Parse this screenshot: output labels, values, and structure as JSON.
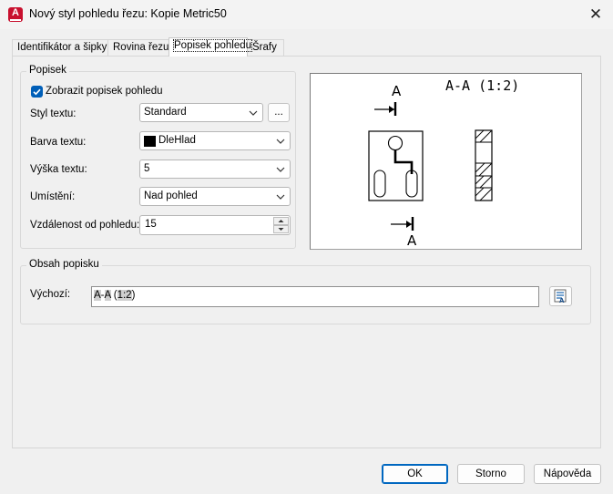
{
  "window": {
    "title": "Nový styl pohledu řezu: Kopie Metric50",
    "close_glyph": "✕"
  },
  "tabs": [
    {
      "label": "Identifikátor a šipky",
      "active": false
    },
    {
      "label": "Rovina řezu",
      "active": false
    },
    {
      "label": "Popisek pohledu",
      "active": true
    },
    {
      "label": "Šrafy",
      "active": false
    }
  ],
  "popisek": {
    "group_title": "Popisek",
    "show_label": {
      "label": "Zobrazit popisek pohledu",
      "checked": true
    },
    "text_style": {
      "label": "Styl textu:",
      "value": "Standard",
      "browse_label": "..."
    },
    "text_color": {
      "label": "Barva textu:",
      "value": "DleHlad",
      "swatch": "#000000"
    },
    "text_height": {
      "label": "Výška textu:",
      "value": "5"
    },
    "placement": {
      "label": "Umístění:",
      "value": "Nad pohled"
    },
    "distance": {
      "label": "Vzdálenost od pohledu:",
      "value": "15"
    }
  },
  "preview": {
    "title_text": "A-A (1:2)",
    "marker_top": "A",
    "marker_bottom": "A"
  },
  "content": {
    "group_title": "Obsah popisku",
    "default": {
      "label": "Výchozí:",
      "value_parts": [
        "A",
        "-",
        "A",
        " (",
        "1:2",
        ")"
      ]
    }
  },
  "buttons": {
    "ok": "OK",
    "cancel": "Storno",
    "help": "Nápověda"
  },
  "icons": {
    "app": "autocad-app-icon",
    "close": "close-icon",
    "field_editor": "field-editor-icon"
  },
  "colors": {
    "accent": "#005fb8",
    "app_icon": "#c8102e"
  }
}
